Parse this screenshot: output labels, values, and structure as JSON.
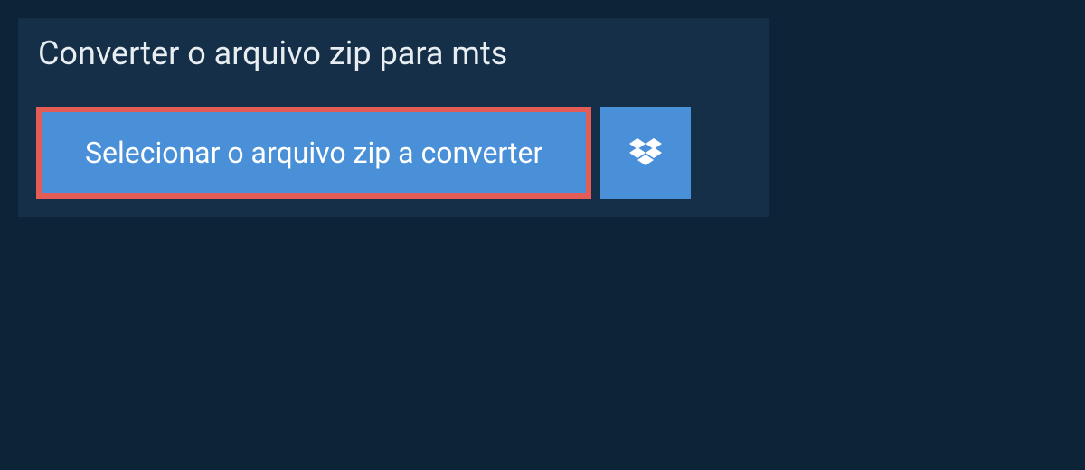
{
  "title": "Converter o arquivo zip para mts",
  "select_button_label": "Selecionar o arquivo zip a converter",
  "icons": {
    "dropbox": "dropbox-icon"
  },
  "colors": {
    "background": "#0d2438",
    "panel": "#142f47",
    "button": "#4a90d9",
    "highlight_border": "#e35d56",
    "text_light": "#e8edf2",
    "text_white": "#ffffff"
  }
}
